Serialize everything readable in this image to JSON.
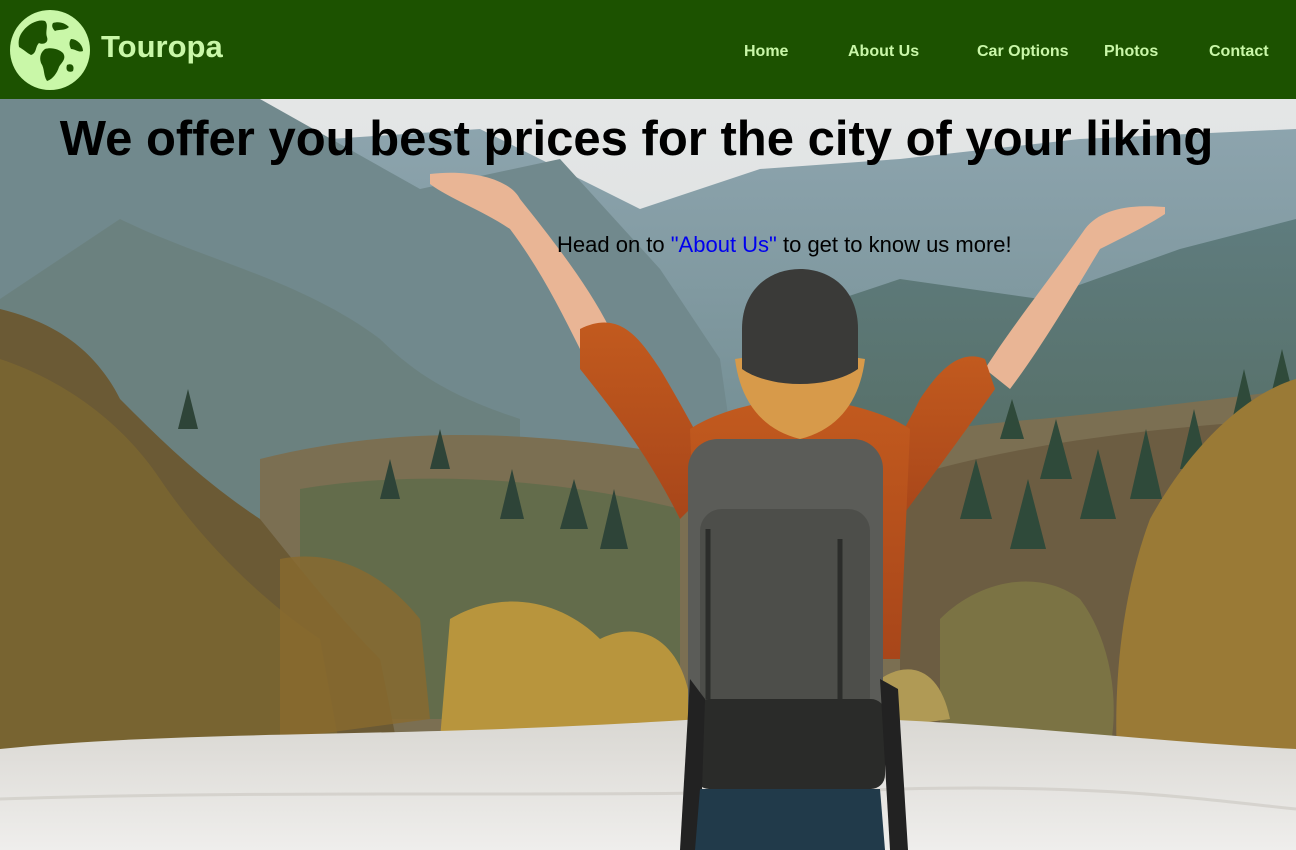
{
  "brand": {
    "name": "Touropa",
    "logo_icon": "globe-icon",
    "accent_color": "#c9f7a8",
    "navbar_color": "#1c5200"
  },
  "nav": {
    "items": [
      {
        "label": "Home"
      },
      {
        "label": "About Us"
      },
      {
        "label": "Car Options"
      },
      {
        "label": "Photos"
      },
      {
        "label": "Contact"
      }
    ]
  },
  "hero": {
    "headline": "We offer you best prices for the city of your liking",
    "sub_before": "Head on to ",
    "sub_link": "\"About Us\"",
    "sub_after": " to get to know us more!",
    "background": "hiker-mountain-river-photo"
  }
}
